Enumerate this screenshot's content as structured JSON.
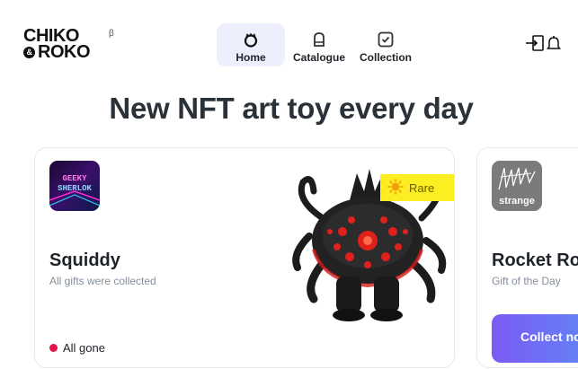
{
  "brand": {
    "logo_line1": "CHIKO",
    "logo_amp": "&",
    "logo_line2": "ROKO",
    "beta": "β"
  },
  "nav": {
    "items": [
      {
        "label": "Home",
        "icon": "home-icon",
        "active": true
      },
      {
        "label": "Catalogue",
        "icon": "catalogue-icon",
        "active": false
      },
      {
        "label": "Collection",
        "icon": "collection-icon",
        "active": false
      }
    ]
  },
  "header_actions": {
    "login_icon": "login-icon",
    "bell_icon": "bell-icon"
  },
  "headline": "New NFT art toy every day",
  "cards": [
    {
      "avatar_text_line1": "GEEKY",
      "avatar_text_line2": "SHERLOK",
      "title": "Squiddy",
      "subtitle": "All gifts were collected",
      "badge": "Rare",
      "status": "All gone",
      "status_color": "#e6134a"
    },
    {
      "avatar_label": "strange",
      "title": "Rocket Ro",
      "subtitle": "Gift of the Day",
      "button_label": "Collect no"
    }
  ],
  "colors": {
    "active_nav_bg": "#eeeffc",
    "badge_yellow": "#fcee20",
    "text_dark": "#2b3139",
    "text_muted": "#848e9c"
  }
}
